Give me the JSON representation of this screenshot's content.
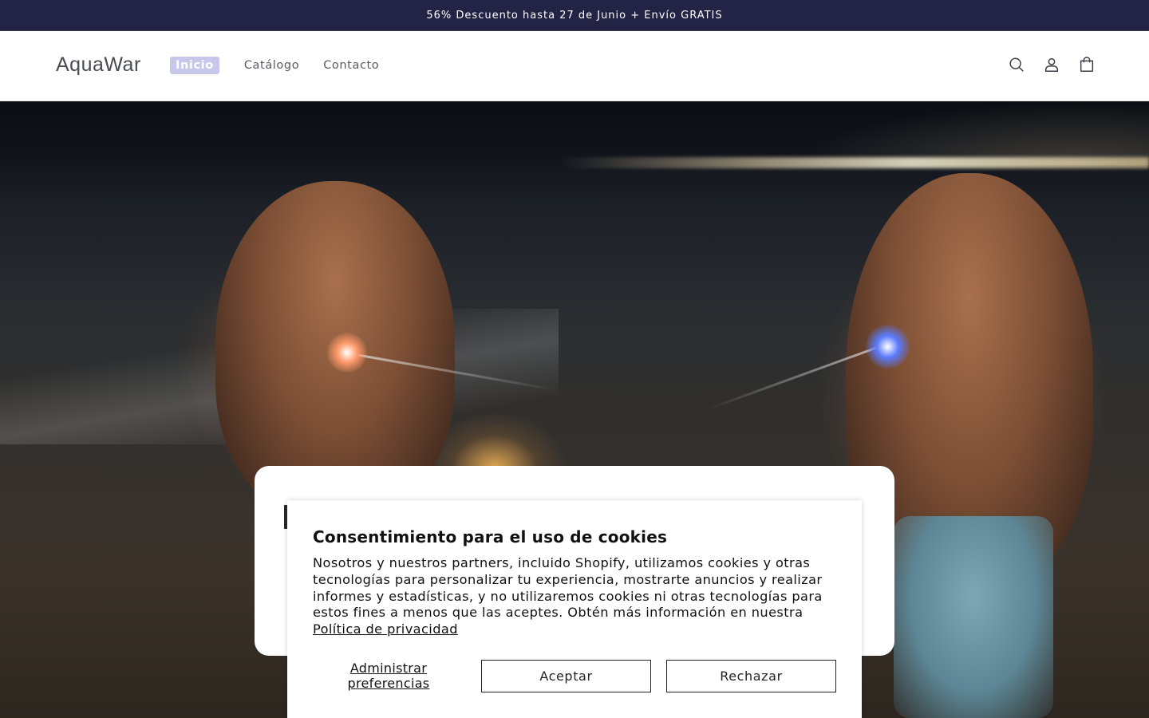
{
  "announcement": {
    "text": "56% Descuento hasta 27 de Junio + Envío GRATIS"
  },
  "header": {
    "logo": "AquaWar",
    "nav": [
      {
        "label": "Inicio",
        "active": true
      },
      {
        "label": "Catálogo",
        "active": false
      },
      {
        "label": "Contacto",
        "active": false
      }
    ],
    "icons": [
      "search-icon",
      "account-icon",
      "cart-icon"
    ]
  },
  "cookie_banner": {
    "title": "Consentimiento para el uso de cookies",
    "body": "Nosotros y nuestros partners, incluido Shopify, utilizamos cookies y otras tecnologías para personalizar tu experiencia, mostrarte anuncios y realizar informes y estadísticas, y no utilizaremos cookies ni otras tecnologías para estos fines a menos que las aceptes. Obtén más información en nuestra",
    "privacy_link": "Política de privacidad",
    "manage_label": "Administrar preferencias",
    "accept_label": "Aceptar",
    "reject_label": "Rechazar"
  },
  "colors": {
    "announcement_bg": "#232345",
    "active_nav_bg": "#c8c8ec"
  }
}
